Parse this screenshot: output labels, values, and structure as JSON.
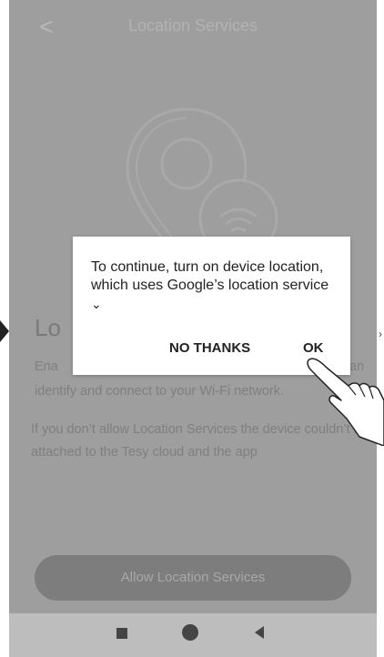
{
  "header": {
    "back_icon": "chevron-left-icon",
    "title": "Location Services"
  },
  "main": {
    "illustration_icon": "location-pin-wifi-icon",
    "heading": "Lo",
    "paragraph1": {
      "part_a": "Ena",
      "part_b": "an",
      "line2": "identify and connect to your Wi-Fi network."
    },
    "paragraph2": "If you don’t allow Location Services the device couldn’t be attached to the Tesy cloud and the app",
    "allow_button": "Allow Location Services"
  },
  "dialog": {
    "text": "To continue, turn on device location, which uses Google’s location service",
    "expand_icon": "chevron-down-icon",
    "no_thanks": "NO THANKS",
    "ok": "OK"
  },
  "navbar": {
    "recents_icon": "square-icon",
    "home_icon": "circle-icon",
    "back_icon": "triangle-back-icon"
  },
  "overlay": {
    "pointer_icon": "pointing-hand-icon"
  }
}
